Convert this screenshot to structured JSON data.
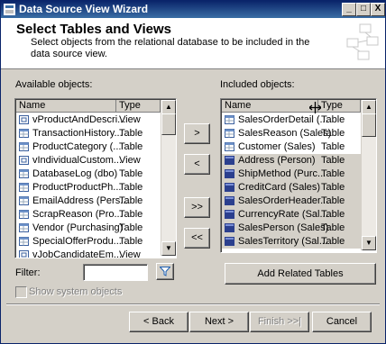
{
  "window": {
    "title": "Data Source View Wizard",
    "minimize": "_",
    "maximize": "□",
    "close": "X"
  },
  "header": {
    "title": "Select Tables and Views",
    "description": "Select objects from the relational database to be included in the data source view."
  },
  "available": {
    "label": "Available objects:",
    "columns": {
      "name": "Name",
      "type": "Type"
    },
    "rows": [
      {
        "name": "vProductAndDescri...",
        "type": "View",
        "icon": "view-icon"
      },
      {
        "name": "TransactionHistory...",
        "type": "Table",
        "icon": "table-icon"
      },
      {
        "name": "ProductCategory (...",
        "type": "Table",
        "icon": "table-icon"
      },
      {
        "name": "vIndividualCustom...",
        "type": "View",
        "icon": "view-icon"
      },
      {
        "name": "DatabaseLog (dbo)",
        "type": "Table",
        "icon": "table-icon"
      },
      {
        "name": "ProductProductPh...",
        "type": "Table",
        "icon": "table-icon"
      },
      {
        "name": "EmailAddress (Pers...",
        "type": "Table",
        "icon": "table-icon"
      },
      {
        "name": "ScrapReason (Pro...",
        "type": "Table",
        "icon": "table-icon"
      },
      {
        "name": "Vendor (Purchasing)",
        "type": "Table",
        "icon": "table-icon"
      },
      {
        "name": "SpecialOfferProdu...",
        "type": "Table",
        "icon": "table-icon"
      },
      {
        "name": "vJobCandidateEm...",
        "type": "View",
        "icon": "view-icon"
      }
    ]
  },
  "included": {
    "label": "Included objects:",
    "columns": {
      "name": "Name",
      "type": "Type"
    },
    "rows": [
      {
        "name": "SalesOrderDetail (...",
        "type": "Table",
        "selected": false
      },
      {
        "name": "SalesReason (Sales)",
        "type": "Table",
        "selected": false
      },
      {
        "name": "Customer (Sales)",
        "type": "Table",
        "selected": false
      },
      {
        "name": "Address (Person)",
        "type": "Table",
        "selected": true
      },
      {
        "name": "ShipMethod (Purc...",
        "type": "Table",
        "selected": true
      },
      {
        "name": "CreditCard (Sales)",
        "type": "Table",
        "selected": true
      },
      {
        "name": "SalesOrderHeader...",
        "type": "Table",
        "selected": true
      },
      {
        "name": "CurrencyRate (Sal...",
        "type": "Table",
        "selected": true
      },
      {
        "name": "SalesPerson (Sales)",
        "type": "Table",
        "selected": true
      },
      {
        "name": "SalesTerritory (Sal...",
        "type": "Table",
        "selected": true
      }
    ]
  },
  "transfer": {
    "add": ">",
    "remove": "<",
    "add_all": ">>",
    "remove_all": "<<"
  },
  "filter": {
    "label": "Filter:",
    "value": ""
  },
  "show_system": "Show system objects",
  "add_related": "Add Related Tables",
  "footer": {
    "back": "< Back",
    "next": "Next >",
    "finish": "Finish >>|",
    "cancel": "Cancel"
  },
  "colors": {
    "title_bg": "#0a246a",
    "face": "#d4d0c8",
    "selection": "#d4d0c8"
  }
}
